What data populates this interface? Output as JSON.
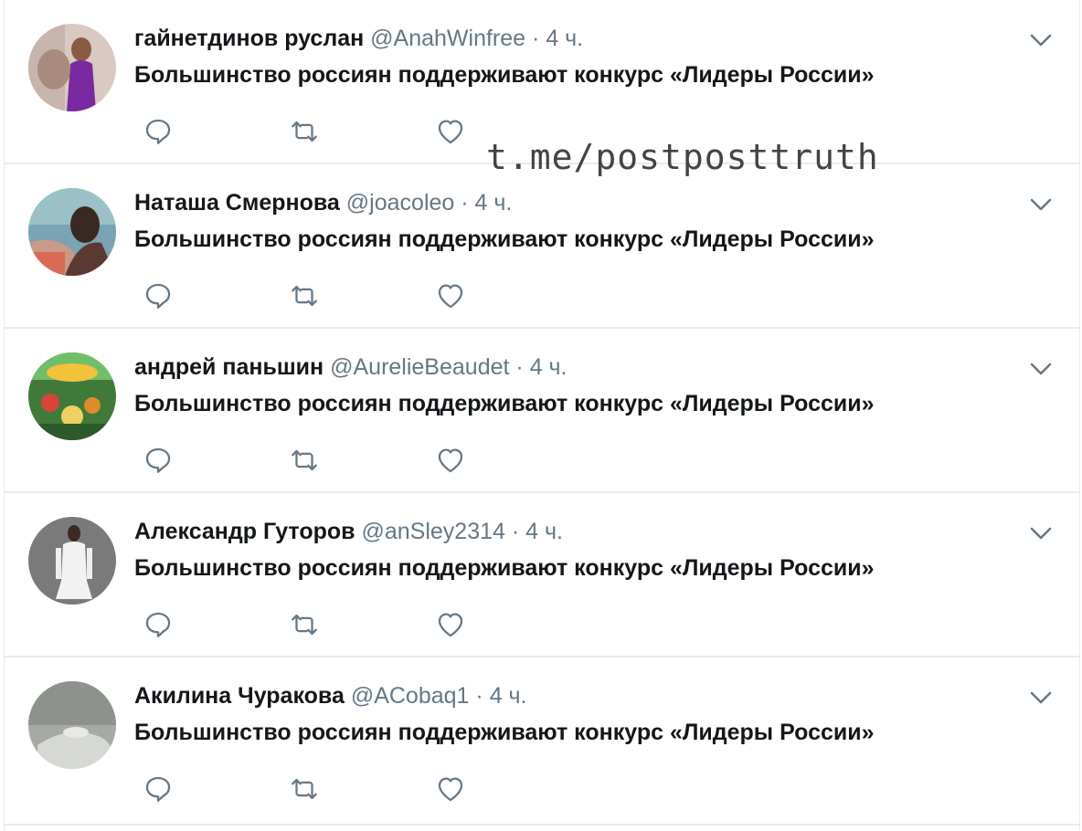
{
  "tweets": [
    {
      "name": "гайнетдинов руслан",
      "handle": "@AnahWinfree",
      "dot": "·",
      "time": "4 ч.",
      "text": "Большинство россиян поддерживают конкурс «Лидеры России»"
    },
    {
      "name": "Наташа Смернова",
      "handle": "@joacoleo",
      "dot": "·",
      "time": "4 ч.",
      "text": "Большинство россиян поддерживают конкурс «Лидеры России»"
    },
    {
      "name": "андрей паньшин",
      "handle": "@AurelieBeaudet",
      "dot": "·",
      "time": "4 ч.",
      "text": "Большинство россиян поддерживают конкурс «Лидеры России»"
    },
    {
      "name": "Александр Гуторов",
      "handle": "@anSley2314",
      "dot": "·",
      "time": "4 ч.",
      "text": "Большинство россиян поддерживают конкурс «Лидеры России»"
    },
    {
      "name": "Акилина Чуракова",
      "handle": "@ACobaq1",
      "dot": "·",
      "time": "4 ч.",
      "text": "Большинство россиян поддерживают конкурс «Лидеры России»"
    }
  ],
  "watermark": "t.me/postposttruth",
  "icons": {
    "reply": "reply-icon",
    "retweet": "retweet-icon",
    "like": "heart-icon",
    "more": "chevron-down-icon"
  },
  "colors": {
    "icon": "#657786",
    "text": "#14171a",
    "muted": "#657786",
    "divider": "#e6ecf0"
  }
}
